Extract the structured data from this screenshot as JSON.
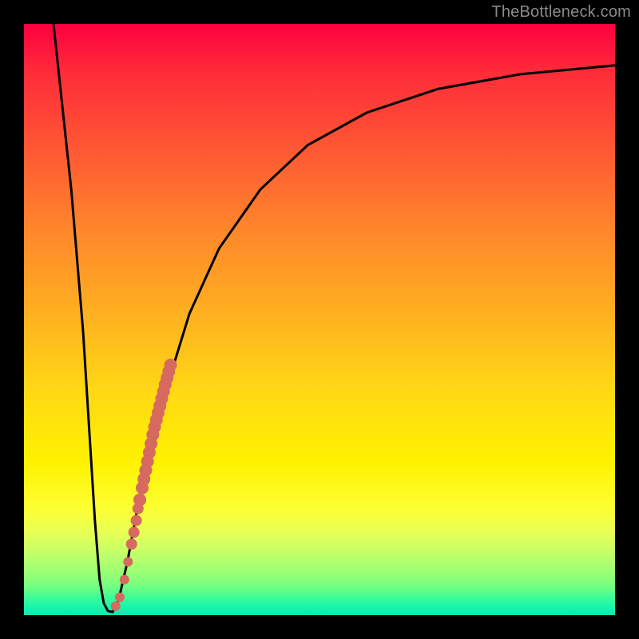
{
  "watermark": "TheBottleneck.com",
  "colors": {
    "curve": "#000000",
    "dots": "#d66a5f",
    "frame": "#000000"
  },
  "chart_data": {
    "type": "line",
    "title": "",
    "xlabel": "",
    "ylabel": "",
    "xlim": [
      0,
      100
    ],
    "ylim": [
      0,
      100
    ],
    "grid": false,
    "series": [
      {
        "name": "bottleneck-curve",
        "x": [
          5,
          8,
          10,
          11,
          12,
          12.8,
          13.5,
          14.2,
          15,
          16,
          17.5,
          19,
          21,
          24,
          28,
          33,
          40,
          48,
          58,
          70,
          84,
          100
        ],
        "y": [
          100,
          72,
          48,
          32,
          16,
          6,
          2,
          0.7,
          0.5,
          2.5,
          9,
          17,
          26,
          38,
          51,
          62,
          72,
          79.5,
          85,
          89,
          91.5,
          93
        ]
      }
    ],
    "overlay_points": {
      "name": "highlight-dots",
      "x": [
        15.5,
        16.2,
        17.0,
        17.6,
        18.2,
        18.6,
        19.0,
        19.3,
        19.6,
        20.0,
        20.3,
        20.6,
        20.9,
        21.2,
        21.5,
        21.8,
        22.1,
        22.4,
        22.7,
        23.0,
        23.3,
        23.6,
        23.9,
        24.2,
        24.5,
        24.8
      ],
      "y": [
        1.5,
        3.0,
        6.0,
        9.0,
        12.0,
        14.0,
        16.0,
        18.0,
        19.5,
        21.5,
        23.0,
        24.5,
        26.0,
        27.5,
        29.0,
        30.5,
        31.8,
        33.0,
        34.2,
        35.4,
        36.6,
        37.8,
        39.0,
        40.1,
        41.2,
        42.3
      ],
      "r": [
        6,
        6,
        6,
        6,
        7,
        7,
        7,
        7,
        8,
        8,
        8,
        8,
        8,
        8,
        8,
        8,
        8,
        8,
        8,
        8,
        8,
        8,
        8,
        8,
        8,
        8
      ]
    }
  }
}
